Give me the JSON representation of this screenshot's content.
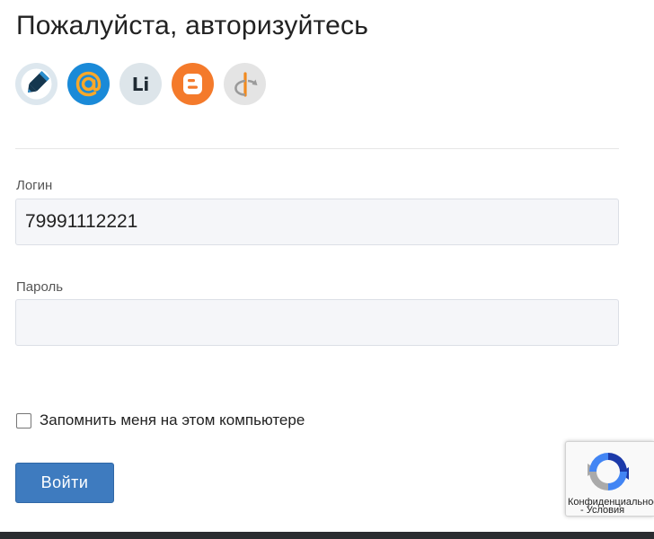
{
  "page": {
    "title": "Пожалуйста, авторизуйтесь"
  },
  "providers": [
    {
      "name": "livejournal",
      "icon": "livejournal-pencil-icon",
      "color": "#dde7ee"
    },
    {
      "name": "mail",
      "icon": "at-sign-icon",
      "color": "#1a8ad8"
    },
    {
      "name": "liveinternet",
      "icon": "li-icon",
      "label": "Li",
      "color": "#dde5ea"
    },
    {
      "name": "blogger",
      "icon": "blogger-icon",
      "color": "#f47a2b"
    },
    {
      "name": "openid",
      "icon": "openid-icon",
      "color": "#e4e4e4"
    }
  ],
  "form": {
    "login_label": "Логин",
    "login_value": "79991112221",
    "password_label": "Пароль",
    "password_value": "",
    "remember_label": "Запомнить меня на этом компьютере",
    "remember_checked": false,
    "submit_label": "Войти"
  },
  "recaptcha": {
    "privacy": "Конфиденциальность",
    "terms": "- Условия"
  },
  "colors": {
    "button": "#3e7bbf",
    "input_bg": "#f5f6f9"
  }
}
